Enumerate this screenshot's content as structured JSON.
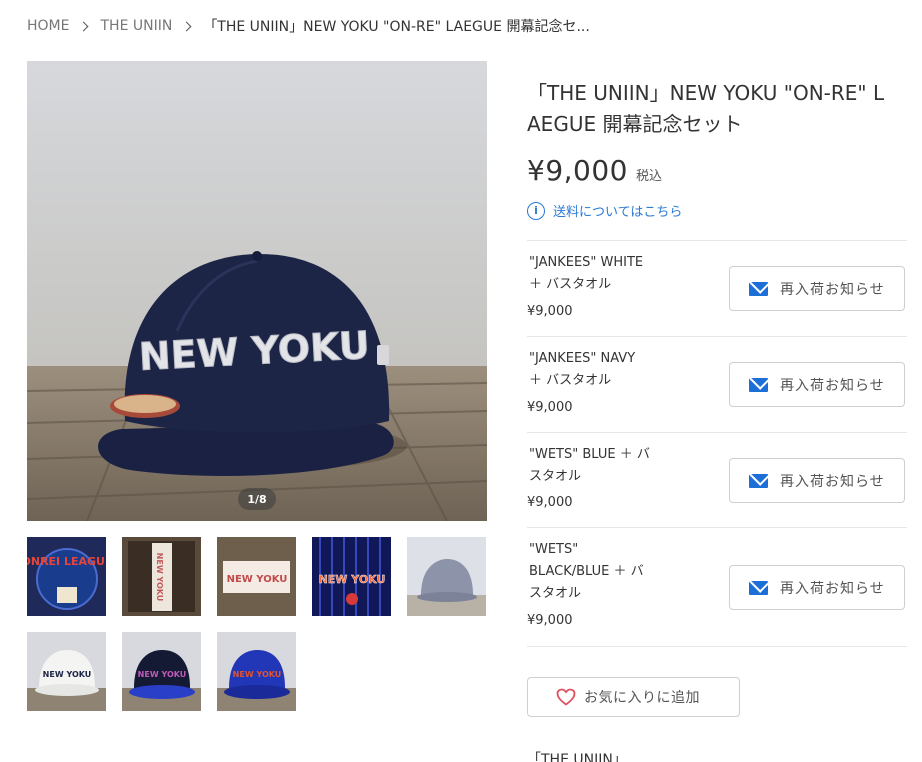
{
  "breadcrumb": {
    "home": "HOME",
    "category": "THE UNIIN",
    "current": "「THE UNIIN」NEW YOKU \"ON-RE\" LAEGUE 開幕記念セ..."
  },
  "gallery": {
    "counter": "1/8",
    "main_cap_text": "NEW YOKU",
    "thumbnails": [
      {
        "label": "ONREI LEAGUE"
      },
      {
        "label": "NEW YOKU"
      },
      {
        "label": "NEW YOKU"
      },
      {
        "label": "NEW YOKU"
      },
      {
        "label": ""
      },
      {
        "label": "NEW YOKU"
      },
      {
        "label": "NEW YOKU"
      },
      {
        "label": "NEW YOKU"
      }
    ]
  },
  "product": {
    "title": "「THE UNIIN」NEW YOKU \"ON-RE\" LAEGUE 開幕記念セット",
    "price": "¥9,000",
    "tax_label": "税込",
    "shipping_link": "送料についてはこちら"
  },
  "variants": [
    {
      "name": "\"JANKEES\" WHITE ＋ バスタオル",
      "price": "¥9,000",
      "button": "再入荷お知らせ"
    },
    {
      "name": "\"JANKEES\" NAVY ＋ バスタオル",
      "price": "¥9,000",
      "button": "再入荷お知らせ"
    },
    {
      "name": "\"WETS\" BLUE ＋ バスタオル",
      "price": "¥9,000",
      "button": "再入荷お知らせ"
    },
    {
      "name": "\"WETS\" BLACK/BLUE ＋ バスタオル",
      "price": "¥9,000",
      "button": "再入荷お知らせ"
    }
  ],
  "favorite": {
    "label": "お気に入りに追加"
  },
  "description": {
    "brand_line": "「THE UNIIN」"
  },
  "colors": {
    "accent": "#2a7ad5",
    "mail": "#1d6fd8",
    "heart": "#e0505e",
    "cap_navy": "#1d2547"
  },
  "icons": [
    "chevron-right-icon",
    "info-icon",
    "mail-icon",
    "heart-icon"
  ]
}
